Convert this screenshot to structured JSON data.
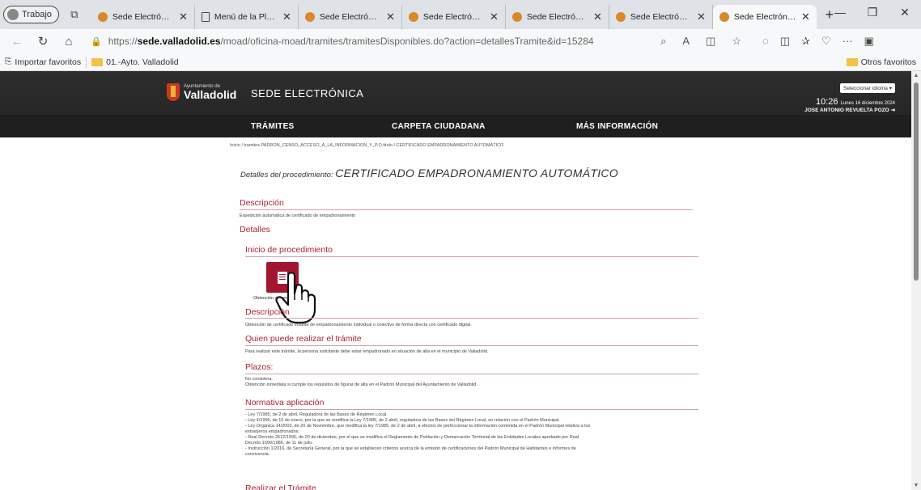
{
  "browser": {
    "profile_label": "Trabajo",
    "tabs": [
      {
        "title": "Sede Electrónica",
        "icon": "sede-favicon"
      },
      {
        "title": "Menú de la Plataforma",
        "icon": "document-favicon"
      },
      {
        "title": "Sede Electrónica",
        "icon": "sede-favicon"
      },
      {
        "title": "Sede Electrónica",
        "icon": "sede-favicon"
      },
      {
        "title": "Sede Electrónica",
        "icon": "sede-favicon"
      },
      {
        "title": "Sede Electrónica",
        "icon": "sede-favicon"
      },
      {
        "title": "Sede Electrónica",
        "icon": "sede-favicon"
      }
    ],
    "url_prefix": "https://",
    "url_host": "sede.valladolid.es",
    "url_path": "/moad/oficina-moad/tramites/tramitesDisponibles.do?action=detallesTramite&id=15284",
    "bookmarks": [
      {
        "label": "Importar favoritos"
      },
      {
        "label": "01.-Ayto. Valladolid"
      }
    ],
    "other_favorites": "Otros favoritos"
  },
  "site": {
    "logo_small": "Ayuntamiento de",
    "logo_big": "Valladolid",
    "title": "SEDE ELECTRÓNICA",
    "language_select": "Seleccionar idioma",
    "time": "10:26",
    "date": "Lunes 16 diciembre 2024",
    "user": "JOSE ANTONIO REVUELTA POZO",
    "nav": [
      "TRÁMITES",
      "CARPETA CIUDADANA",
      "MÁS INFORMACIÓN"
    ],
    "accent_color": "#a31530"
  },
  "page": {
    "breadcrumb": "Inicio / tramites.PADRON_CENSO_ACCESO_A_LA_INFORMACION_Y_P.O.titulo / CERTIFICADO EMPADRONAMIENTO AUTOMÁTICO",
    "heading_prefix": "Detalles del procedimiento:",
    "heading_title": "CERTIFICADO EMPADRONAMIENTO AUTOMÁTICO",
    "descripcion_title": "Descripción",
    "descripcion_text": "Expedición automática de certificado de empadronamiento",
    "detalles_title": "Detalles",
    "inicio_title": "Inicio de procedimiento",
    "proc_button_label": "Obtención de certificado",
    "desc2_title": "Descripción",
    "desc2_text": "Obtención de certificado volante de empadronamiento individual o colectivo de forma directa con certificado digital.",
    "quien_title": "Quien puede realizar el trámite",
    "quien_text": "Para realizar este trámite, la persona solicitante debe estar empadronado en situación de alta en el municipio de Valladolid.",
    "plazos_title": "Plazos:",
    "plazos_text_1": "No considera.",
    "plazos_text_2": "Obtención inmediata si cumple los requisitos de figurar de alta en el Padrón Municipal del Ayuntamiento de Valladolid.",
    "normativa_title": "Normativa aplicación",
    "normativa_lines": [
      "- Ley 7/1985, de 2 de abril, Reguladora de las Bases de Régimen Local.",
      "- Ley 4/1996, de 10 de enero, por la que se modifica la Ley 7/1985, de 2 abril, reguladora de las Bases del Régimen Local, en relación con el Padrón Municipal.",
      "- Ley Orgánica 14/2003, de 20 de Noviembre, que modifica la ley 7/1985, de 2 de abril, a efectos de perfeccionar la información contenida en el Padrón Municipal relativa a los",
      "extranjeros empadronados.",
      "- Real Decreto 2612/1996, de 20 de diciembre, por el que se modifica el Reglamento de Población y Demarcación Territorial de las Entidades Locales aprobado por Real",
      "Decreto 1690/1986, de 11 de julio.",
      "- Instrucción 1/2016, de Secretaría General, por la que se establecen criterios acerca de la emisión de certificaciones del Padrón Municipal de Habitantes e Informes de",
      "convivencia."
    ],
    "realizar_title": "Realizar el Trámite"
  }
}
